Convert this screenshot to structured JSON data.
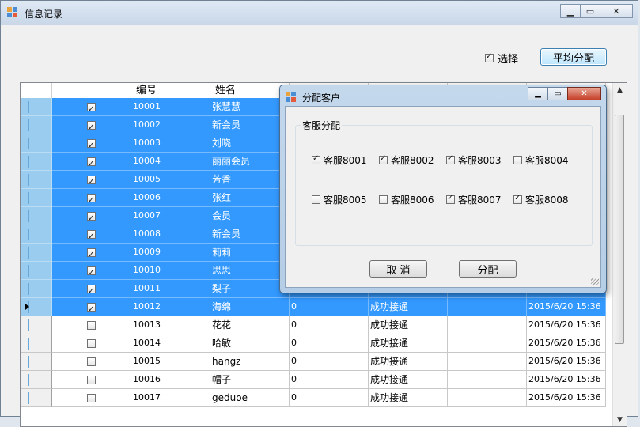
{
  "window": {
    "title": "信息记录"
  },
  "toolbar": {
    "select_label": "选择",
    "select_checked": true,
    "average_button": "平均分配"
  },
  "grid": {
    "headers": [
      "",
      "编号",
      "姓名",
      "",
      "",
      "",
      ""
    ],
    "rows": [
      {
        "checked": true,
        "id": "10001",
        "name": "张慧慧",
        "a": "",
        "b": "",
        "c": "",
        "d": "",
        "selected": true
      },
      {
        "checked": true,
        "id": "10002",
        "name": "新会员",
        "a": "",
        "b": "",
        "c": "",
        "d": "",
        "selected": true
      },
      {
        "checked": true,
        "id": "10003",
        "name": "刘晓",
        "a": "",
        "b": "",
        "c": "",
        "d": "",
        "selected": true
      },
      {
        "checked": true,
        "id": "10004",
        "name": "丽丽会员",
        "a": "",
        "b": "",
        "c": "",
        "d": "",
        "selected": true
      },
      {
        "checked": true,
        "id": "10005",
        "name": "芳香",
        "a": "",
        "b": "",
        "c": "",
        "d": "",
        "selected": true
      },
      {
        "checked": true,
        "id": "10006",
        "name": "张红",
        "a": "",
        "b": "",
        "c": "",
        "d": "",
        "selected": true
      },
      {
        "checked": true,
        "id": "10007",
        "name": "会员",
        "a": "",
        "b": "",
        "c": "",
        "d": "",
        "selected": true
      },
      {
        "checked": true,
        "id": "10008",
        "name": "新会员",
        "a": "",
        "b": "",
        "c": "",
        "d": "",
        "selected": true
      },
      {
        "checked": true,
        "id": "10009",
        "name": "莉莉",
        "a": "",
        "b": "",
        "c": "",
        "d": "",
        "selected": true
      },
      {
        "checked": true,
        "id": "10010",
        "name": "思思",
        "a": "",
        "b": "",
        "c": "",
        "d": "",
        "selected": true
      },
      {
        "checked": true,
        "id": "10011",
        "name": "梨子",
        "a": "",
        "b": "",
        "c": "",
        "d": "",
        "selected": true
      },
      {
        "checked": true,
        "id": "10012",
        "name": "海绵",
        "a": "0",
        "b": "成功接通",
        "c": "",
        "d": "2015/6/20 15:36",
        "selected": true,
        "current": true
      },
      {
        "checked": false,
        "id": "10013",
        "name": "花花",
        "a": "0",
        "b": "成功接通",
        "c": "",
        "d": "2015/6/20 15:36",
        "selected": false
      },
      {
        "checked": false,
        "id": "10014",
        "name": "哈敏",
        "a": "0",
        "b": "成功接通",
        "c": "",
        "d": "2015/6/20 15:36",
        "selected": false
      },
      {
        "checked": false,
        "id": "10015",
        "name": "hangz",
        "a": "0",
        "b": "成功接通",
        "c": "",
        "d": "2015/6/20 15:36",
        "selected": false
      },
      {
        "checked": false,
        "id": "10016",
        "name": "帽子",
        "a": "0",
        "b": "成功接通",
        "c": "",
        "d": "2015/6/20 15:36",
        "selected": false
      },
      {
        "checked": false,
        "id": "10017",
        "name": "geduoe",
        "a": "0",
        "b": "成功接通",
        "c": "",
        "d": "2015/6/20 15:36",
        "selected": false
      }
    ]
  },
  "dialog": {
    "title": "分配客户",
    "group_label": "客服分配",
    "agents": [
      {
        "label": "客服8001",
        "checked": true
      },
      {
        "label": "客服8002",
        "checked": true
      },
      {
        "label": "客服8003",
        "checked": true
      },
      {
        "label": "客服8004",
        "checked": false
      },
      {
        "label": "客服8005",
        "checked": false
      },
      {
        "label": "客服8006",
        "checked": false
      },
      {
        "label": "客服8007",
        "checked": true
      },
      {
        "label": "客服8008",
        "checked": true
      }
    ],
    "cancel_button": "取  消",
    "assign_button": "分配"
  },
  "colors": {
    "selection": "#3399ff",
    "row_header_selected": "#99ccee"
  }
}
